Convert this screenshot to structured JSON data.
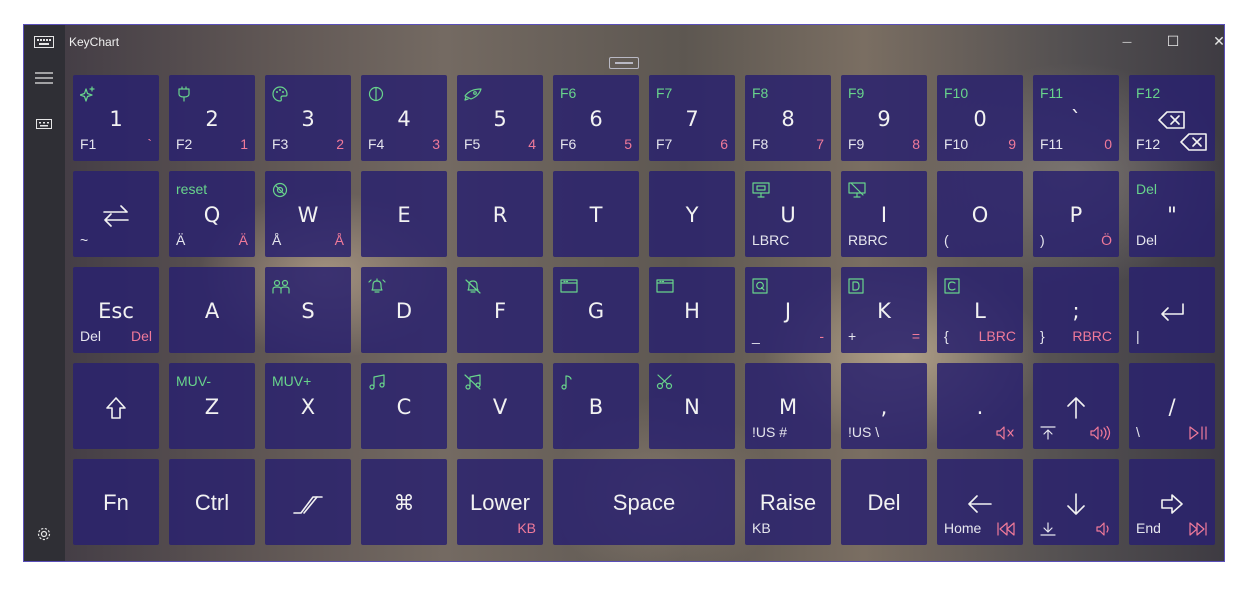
{
  "window": {
    "title": "KeyChart",
    "controls": {
      "minimize": "—",
      "maximize": "☐",
      "close": "✕"
    }
  },
  "sidebar": {
    "icons": [
      "keyboard-icon",
      "hamburger-menu-icon",
      "keyboard-small-icon",
      "settings-gear-icon"
    ]
  },
  "colors": {
    "key_bg": "#2a226e",
    "top_label": "#68d48c",
    "alt_label": "#f07a9a",
    "text": "#f2f2f2"
  },
  "keys": [
    [
      {
        "main": "1",
        "tl_icon": "sparkle-icon",
        "bl": "F1",
        "br": "`"
      },
      {
        "main": "2",
        "tl_icon": "plug-icon",
        "bl": "F2",
        "br": "1"
      },
      {
        "main": "3",
        "tl_icon": "palette-icon",
        "bl": "F3",
        "br": "2"
      },
      {
        "main": "4",
        "tl_icon": "brightness-icon",
        "bl": "F4",
        "br": "3"
      },
      {
        "main": "5",
        "tl_icon": "rocket-icon",
        "bl": "F5",
        "br": "4"
      },
      {
        "main": "6",
        "tl": "F6",
        "bl": "F6",
        "br": "5"
      },
      {
        "main": "7",
        "tl": "F7",
        "bl": "F7",
        "br": "6"
      },
      {
        "main": "8",
        "tl": "F8",
        "bl": "F8",
        "br": "7"
      },
      {
        "main": "9",
        "tl": "F9",
        "bl": "F9",
        "br": "8"
      },
      {
        "main": "0",
        "tl": "F10",
        "bl": "F10",
        "br": "9"
      },
      {
        "main": "`",
        "tl": "F11",
        "bl": "F11",
        "br": "0"
      },
      {
        "main_icon": "backspace-icon",
        "tl": "F12",
        "bl": "F12",
        "br_icon": "backspace-icon"
      }
    ],
    [
      {
        "main_icon": "swap-arrows-icon",
        "bl": "~"
      },
      {
        "main": "Q",
        "tl": "reset",
        "bl": "Ä",
        "br": "Ä"
      },
      {
        "main": "W",
        "tl_icon": "no-symbol-icon",
        "bl": "Å",
        "br": "Å"
      },
      {
        "main": "E"
      },
      {
        "main": "R"
      },
      {
        "main": "T"
      },
      {
        "main": "Y"
      },
      {
        "main": "U",
        "tl_icon": "monitor-icon",
        "bl": "LBRC"
      },
      {
        "main": "I",
        "tl_icon": "monitor-off-icon",
        "bl": "RBRC"
      },
      {
        "main": "O",
        "bl": "("
      },
      {
        "main": "P",
        "bl": ")",
        "br": "Ö"
      },
      {
        "main": "\"",
        "tl": "Del",
        "bl": "Del"
      }
    ],
    [
      {
        "main": "Esc",
        "bl": "Del",
        "br": "Del"
      },
      {
        "main": "A"
      },
      {
        "main": "S",
        "tl_icon": "bluetooth-people-icon"
      },
      {
        "main": "D",
        "tl_icon": "alarm-icon"
      },
      {
        "main": "F",
        "tl_icon": "bell-off-icon"
      },
      {
        "main": "G",
        "tl_icon": "window-icon"
      },
      {
        "main": "H",
        "tl_icon": "window-icon"
      },
      {
        "main": "J",
        "tl_icon": "q-box-icon",
        "bl": "_",
        "br": "-"
      },
      {
        "main": "K",
        "tl_icon": "d-box-icon",
        "bl": "+",
        "br": "="
      },
      {
        "main": "L",
        "tl_icon": "c-box-icon",
        "bl": "{",
        "br": "LBRC"
      },
      {
        "main": ";",
        "bl": "}",
        "br": "RBRC"
      },
      {
        "main_icon": "enter-icon",
        "bl": "|"
      }
    ],
    [
      {
        "main_icon": "shift-icon"
      },
      {
        "main": "Z",
        "tl": "MUV-"
      },
      {
        "main": "X",
        "tl": "MUV+"
      },
      {
        "main": "C",
        "tl_icon": "music-note-icon"
      },
      {
        "main": "V",
        "tl_icon": "music-off-icon"
      },
      {
        "main": "B",
        "tl_icon": "single-note-icon"
      },
      {
        "main": "N",
        "tl_icon": "scissors-icon"
      },
      {
        "main": "M",
        "bl": "!US #"
      },
      {
        "main": ",",
        "bl": "!US \\"
      },
      {
        "main": ".",
        "br_icon": "mute-icon"
      },
      {
        "main_icon": "arrow-up-icon",
        "bl_icon": "page-up-icon",
        "br_icon": "volume-up-icon"
      },
      {
        "main": "/",
        "bl": "\\",
        "br_icon": "play-pause-icon"
      }
    ],
    [
      {
        "main": "Fn",
        "wide": true
      },
      {
        "main": "Ctrl",
        "wide": true
      },
      {
        "main_icon": "step-icon"
      },
      {
        "main": "⌘"
      },
      {
        "main": "Lower",
        "wide": true,
        "br": "KB"
      },
      {
        "main": "Space",
        "wide": true,
        "span": 2
      },
      {
        "main": "Raise",
        "wide": true,
        "bl": "KB"
      },
      {
        "main": "Del",
        "wide": true
      },
      {
        "main_icon": "arrow-left-icon",
        "bl": "Home",
        "br_icon": "skip-back-icon"
      },
      {
        "main_icon": "arrow-down-icon",
        "bl_icon": "page-down-icon",
        "br_icon": "volume-down-icon"
      },
      {
        "main_icon": "arrow-right-icon",
        "bl": "End",
        "br_icon": "skip-forward-icon"
      }
    ]
  ]
}
